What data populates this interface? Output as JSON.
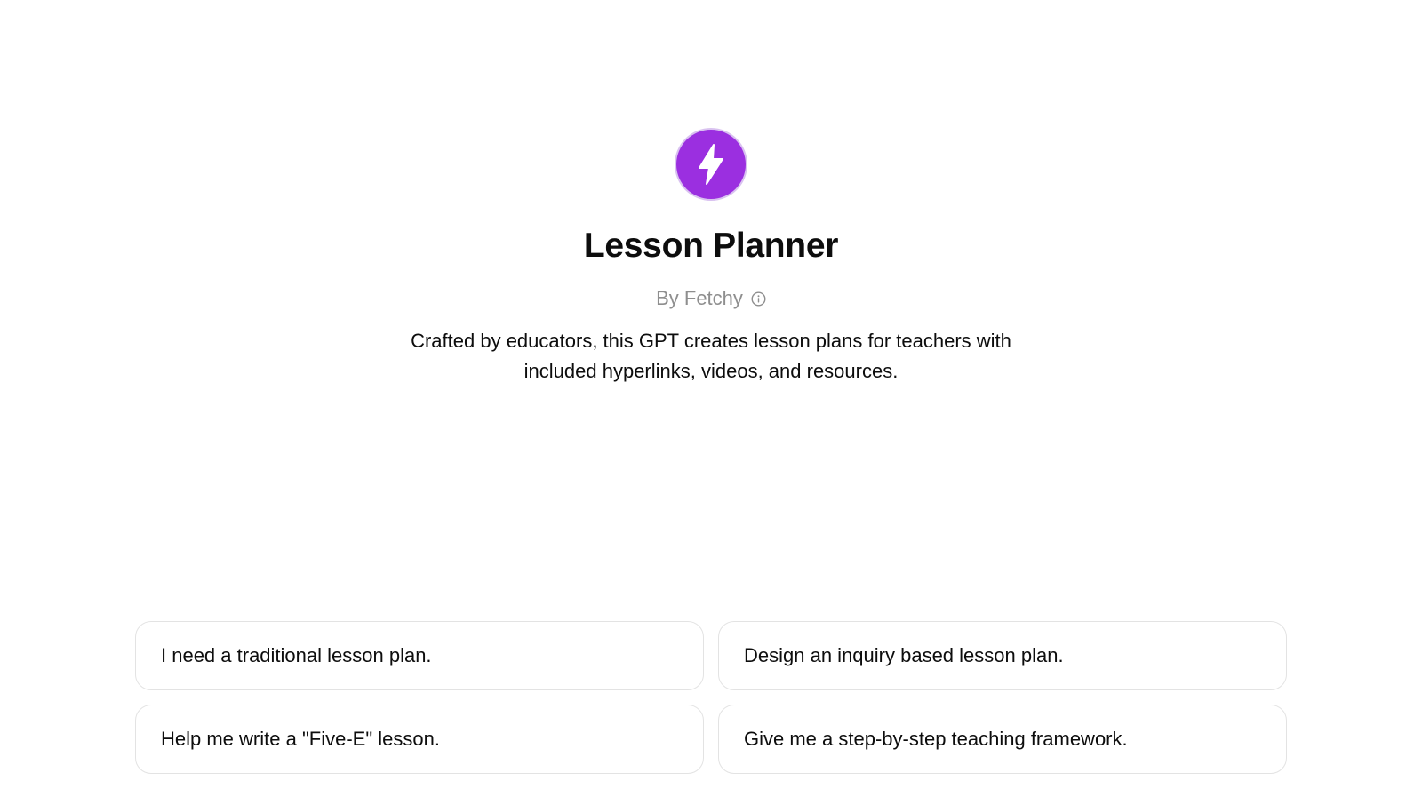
{
  "gpt": {
    "title": "Lesson Planner",
    "byline": "By Fetchy",
    "description": "Crafted by educators, this GPT creates lesson plans for teachers with included hyperlinks, videos, and resources.",
    "avatar_icon": "lightning-bolt-icon",
    "avatar_color": "#9b2fe0",
    "info_icon": "info-icon"
  },
  "suggestions": [
    {
      "label": "I need a traditional lesson plan."
    },
    {
      "label": "Design an inquiry based lesson plan."
    },
    {
      "label": "Help me write a \"Five-E\" lesson."
    },
    {
      "label": "Give me a step-by-step teaching framework."
    }
  ]
}
